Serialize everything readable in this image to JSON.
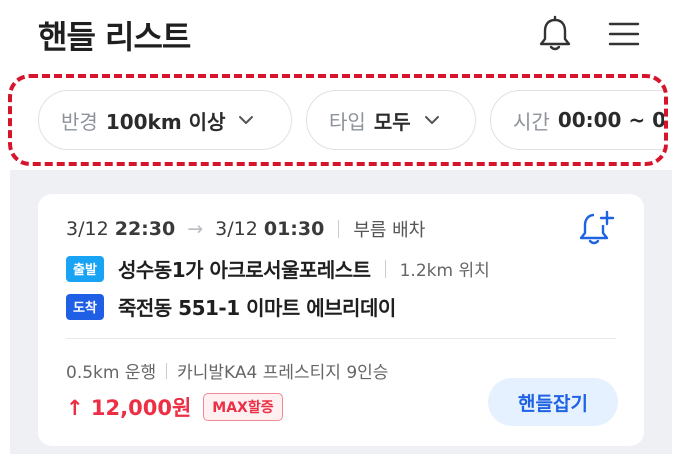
{
  "header": {
    "title": "핸들 리스트",
    "bell_icon": "bell-icon",
    "menu_icon": "menu-icon"
  },
  "filters": [
    {
      "label": "반경",
      "value": "100km 이상"
    },
    {
      "label": "타입",
      "value": "모두"
    },
    {
      "label": "시간",
      "value": "00:00 ~ 0"
    }
  ],
  "card": {
    "departure_date": "3/12",
    "departure_time": "22:30",
    "arrival_date": "3/12",
    "arrival_time": "01:30",
    "mode": "부름 배차",
    "departure_tag": "출발",
    "departure_place": "성수동1가 아크로서울포레스트",
    "departure_distance": "1.2km 위치",
    "arrival_tag": "도착",
    "arrival_place": "죽전동 551-1 이마트 에브리데이",
    "drive_distance": "0.5km 운행",
    "car": "카니발KA4 프레스티지 9인승",
    "price": "↑ 12,000원",
    "badge": "MAX할증",
    "action": "핸들잡기"
  },
  "colors": {
    "accent": "#1f63e3",
    "price": "#ec2f44",
    "highlight_border": "#d6152d",
    "departure_tag": "#19a3f5",
    "arrival_tag": "#1f5fe6"
  }
}
